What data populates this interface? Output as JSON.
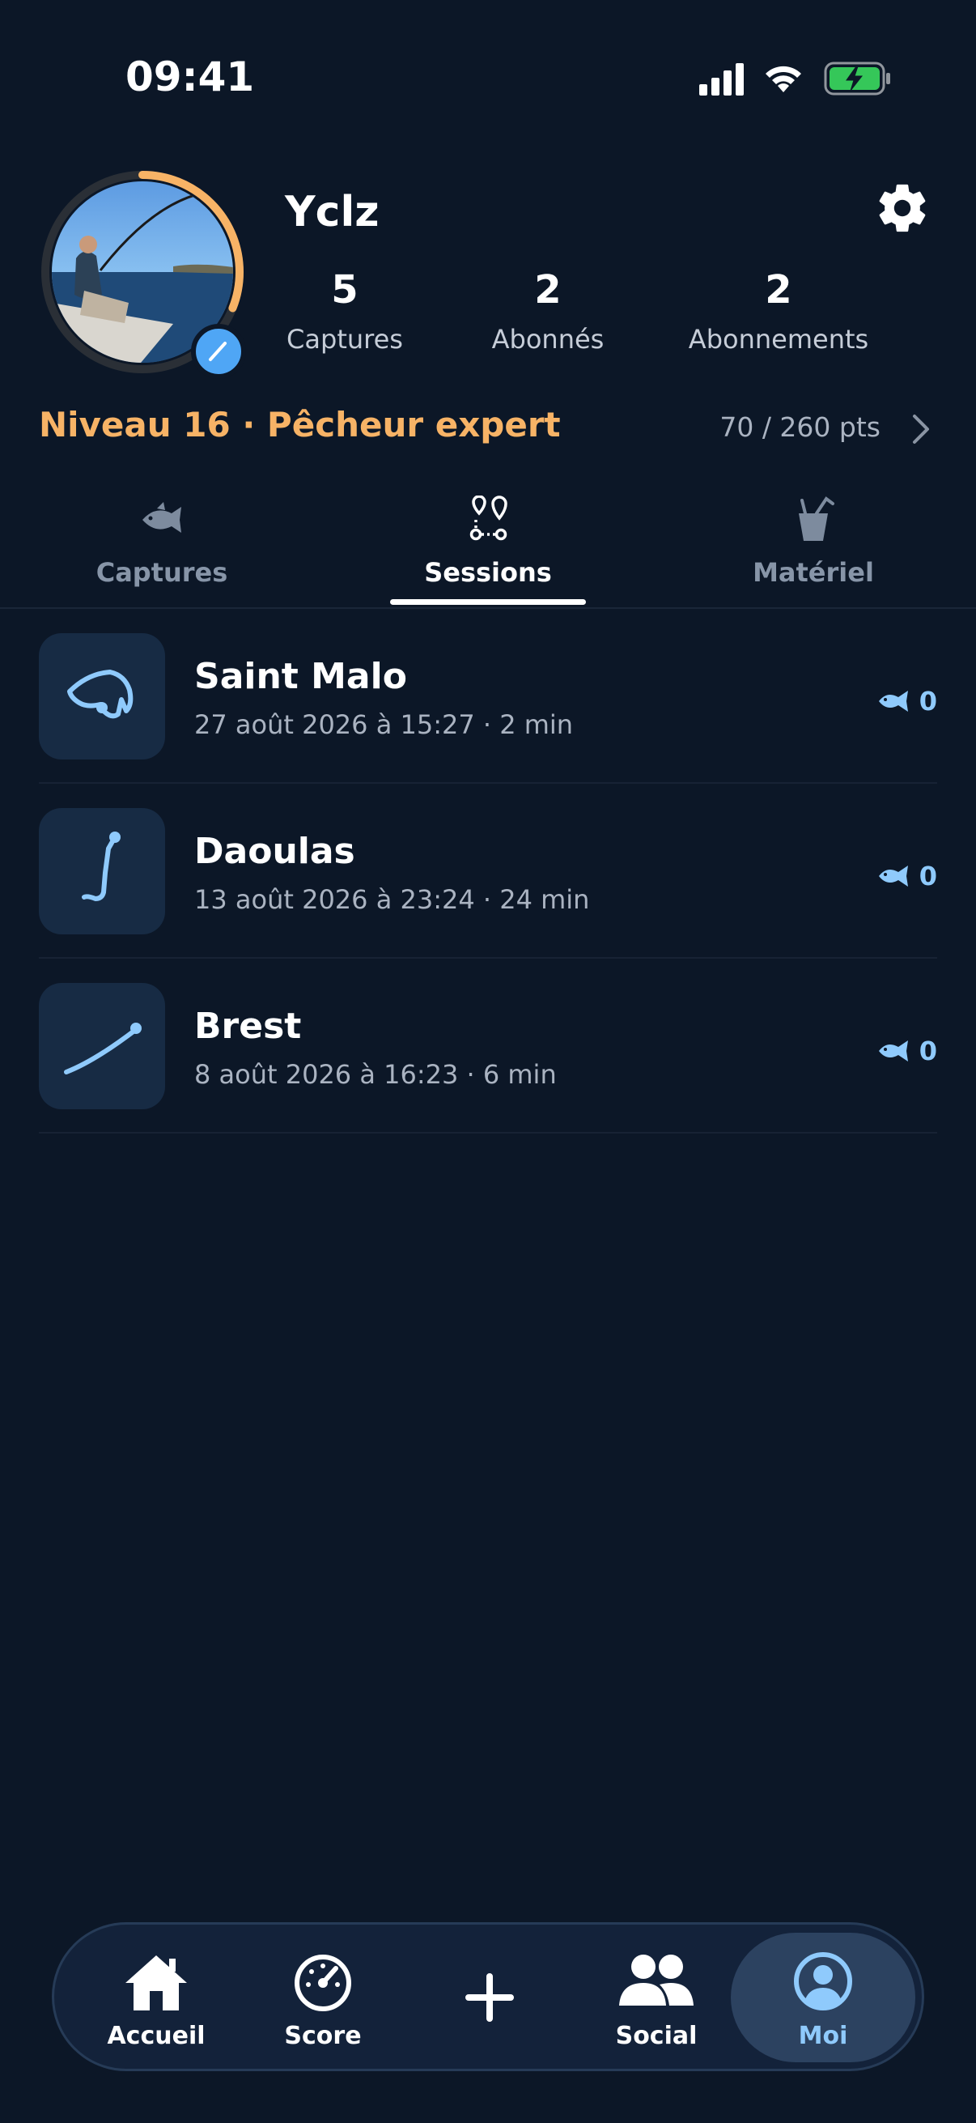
{
  "status_bar": {
    "time": "09:41"
  },
  "profile": {
    "username": "Yclz",
    "stats": [
      {
        "value": "5",
        "label": "Captures"
      },
      {
        "value": "2",
        "label": "Abonnés"
      },
      {
        "value": "2",
        "label": "Abonnements"
      }
    ],
    "level_title": "Niveau 16 · Pêcheur expert",
    "level_points": "70 / 260 pts",
    "level_progress": 0.27
  },
  "tabs": [
    {
      "label": "Captures",
      "icon": "fish-icon",
      "active": false
    },
    {
      "label": "Sessions",
      "icon": "route-icon",
      "active": true
    },
    {
      "label": "Matériel",
      "icon": "bucket-icon",
      "active": false
    }
  ],
  "sessions": [
    {
      "title": "Saint Malo",
      "meta": "27 août 2026 à 15:27 · 2 min",
      "catches": "0"
    },
    {
      "title": "Daoulas",
      "meta": "13 août 2026 à 23:24 · 24 min",
      "catches": "0"
    },
    {
      "title": "Brest",
      "meta": "8 août 2026 à 16:23 · 6 min",
      "catches": "0"
    }
  ],
  "bottom_nav": [
    {
      "label": "Accueil",
      "icon": "home-icon"
    },
    {
      "label": "Score",
      "icon": "gauge-icon"
    },
    {
      "label": "",
      "icon": "plus-icon"
    },
    {
      "label": "Social",
      "icon": "people-icon"
    },
    {
      "label": "Moi",
      "icon": "user-circle-icon",
      "active": true
    }
  ],
  "colors": {
    "background": "#0c1727",
    "accent_orange": "#f7b366",
    "accent_blue": "#8fcafc",
    "edit_badge": "#4fa6f5"
  }
}
